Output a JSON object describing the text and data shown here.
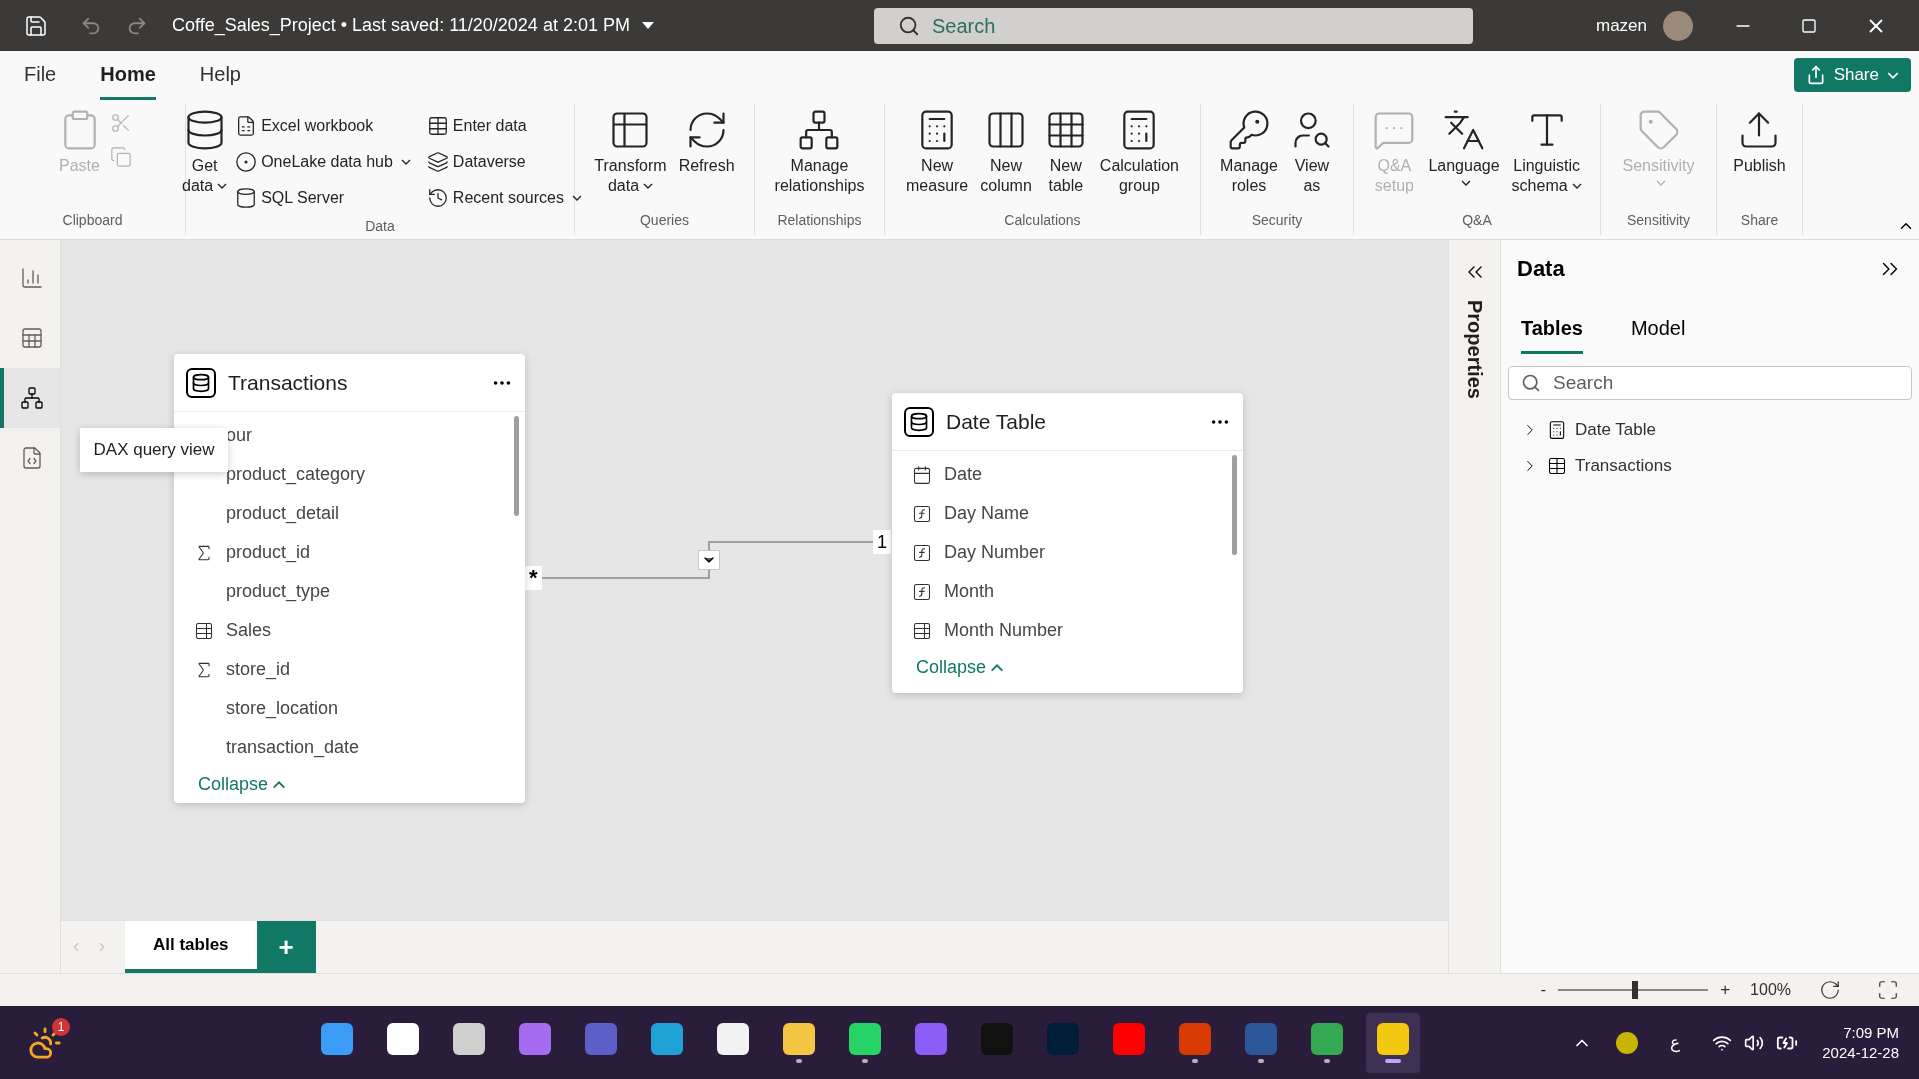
{
  "title_bar": {
    "file_title": "Coffe_Sales_Project • Last saved: 11/20/2024 at 2:01 PM",
    "search_placeholder": "Search",
    "user": "mazen"
  },
  "menu_tabs": [
    {
      "label": "File",
      "selected": false
    },
    {
      "label": "Home",
      "selected": true
    },
    {
      "label": "Help",
      "selected": false
    }
  ],
  "share_button": "Share",
  "ribbon_groups": [
    {
      "label": "Clipboard",
      "buttons": [
        {
          "lines": [
            "Paste"
          ],
          "kind": "large",
          "disabled": true,
          "dropdown": false
        },
        {
          "kind": "icon",
          "disabled": true,
          "dropdown": false
        },
        {
          "kind": "icon",
          "disabled": true,
          "dropdown": false
        }
      ]
    },
    {
      "label": "Data",
      "buttons": [
        {
          "lines": [
            "Get",
            "data"
          ],
          "kind": "large",
          "disabled": false,
          "dropdown": true
        },
        {
          "lines": [
            "Excel workbook"
          ],
          "kind": "small",
          "disabled": false,
          "dropdown": false
        },
        {
          "lines": [
            "OneLake data hub"
          ],
          "kind": "small",
          "disabled": false,
          "dropdown": true
        },
        {
          "lines": [
            "SQL Server"
          ],
          "kind": "small",
          "disabled": false,
          "dropdown": false
        },
        {
          "lines": [
            "Enter data"
          ],
          "kind": "small",
          "disabled": false,
          "dropdown": false
        },
        {
          "lines": [
            "Dataverse"
          ],
          "kind": "small",
          "disabled": false,
          "dropdown": false
        },
        {
          "lines": [
            "Recent sources"
          ],
          "kind": "small",
          "disabled": false,
          "dropdown": true
        }
      ]
    },
    {
      "label": "Queries",
      "buttons": [
        {
          "lines": [
            "Transform",
            "data"
          ],
          "kind": "large",
          "disabled": false,
          "dropdown": true
        },
        {
          "lines": [
            "Refresh"
          ],
          "kind": "large",
          "disabled": false,
          "dropdown": false
        }
      ]
    },
    {
      "label": "Relationships",
      "buttons": [
        {
          "lines": [
            "Manage",
            "relationships"
          ],
          "kind": "large",
          "disabled": false,
          "dropdown": false
        }
      ]
    },
    {
      "label": "Calculations",
      "buttons": [
        {
          "lines": [
            "New",
            "measure"
          ],
          "kind": "large",
          "disabled": false,
          "dropdown": false
        },
        {
          "lines": [
            "New",
            "column"
          ],
          "kind": "large",
          "disabled": false,
          "dropdown": false
        },
        {
          "lines": [
            "New",
            "table"
          ],
          "kind": "large",
          "disabled": false,
          "dropdown": false
        },
        {
          "lines": [
            "Calculation",
            "group"
          ],
          "kind": "large",
          "disabled": false,
          "dropdown": false
        }
      ]
    },
    {
      "label": "Security",
      "buttons": [
        {
          "lines": [
            "Manage",
            "roles"
          ],
          "kind": "large",
          "disabled": false,
          "dropdown": false
        },
        {
          "lines": [
            "View",
            "as"
          ],
          "kind": "large",
          "disabled": false,
          "dropdown": false
        }
      ]
    },
    {
      "label": "Q&A",
      "buttons": [
        {
          "lines": [
            "Q&A",
            "setup"
          ],
          "kind": "large",
          "disabled": true,
          "dropdown": false
        },
        {
          "lines": [
            "Language"
          ],
          "kind": "large",
          "disabled": false,
          "dropdown": true
        },
        {
          "lines": [
            "Linguistic",
            "schema"
          ],
          "kind": "large",
          "disabled": false,
          "dropdown": true
        }
      ]
    },
    {
      "label": "Sensitivity",
      "buttons": [
        {
          "lines": [
            "Sensitivity"
          ],
          "kind": "large",
          "disabled": true,
          "dropdown": true
        }
      ]
    },
    {
      "label": "Share",
      "buttons": [
        {
          "lines": [
            "Publish"
          ],
          "kind": "large",
          "disabled": false,
          "dropdown": false
        }
      ]
    }
  ],
  "view_nav": [
    {
      "selected": false
    },
    {
      "selected": false
    },
    {
      "selected": true
    },
    {
      "selected": false
    }
  ],
  "tooltip": "DAX query view",
  "tables": [
    {
      "name": "Transactions",
      "collapse": "Collapse",
      "fields": [
        {
          "name": "our",
          "kind": "plain"
        },
        {
          "name": "product_category",
          "kind": "plain"
        },
        {
          "name": "product_detail",
          "kind": "plain"
        },
        {
          "name": "product_id",
          "kind": "sum"
        },
        {
          "name": "product_type",
          "kind": "plain"
        },
        {
          "name": "Sales",
          "kind": "calc_sum"
        },
        {
          "name": "store_id",
          "kind": "sum"
        },
        {
          "name": "store_location",
          "kind": "plain"
        },
        {
          "name": "transaction_date",
          "kind": "plain"
        }
      ]
    },
    {
      "name": "Date Table",
      "collapse": "Collapse",
      "fields": [
        {
          "name": "Date",
          "kind": "date"
        },
        {
          "name": "Day Name",
          "kind": "fx"
        },
        {
          "name": "Day Number",
          "kind": "fx"
        },
        {
          "name": "Month",
          "kind": "fx"
        },
        {
          "name": "Month Number",
          "kind": "calc_sum"
        }
      ]
    }
  ],
  "relationship": {
    "many_label": "*",
    "one_label": "1"
  },
  "properties_label": "Properties",
  "data_pane": {
    "title": "Data",
    "tabs": [
      {
        "label": "Tables",
        "selected": true
      },
      {
        "label": "Model",
        "selected": false
      }
    ],
    "search_placeholder": "Search",
    "tree": [
      {
        "label": "Date Table",
        "kind": "calc_table",
        "expanded": false
      },
      {
        "label": "Transactions",
        "kind": "table",
        "expanded": false
      }
    ]
  },
  "page_tabs": [
    {
      "label": "All tables",
      "selected": true
    }
  ],
  "add_tab": "+",
  "zoom": {
    "minus": "-",
    "plus": "+",
    "level": 0.51,
    "reading": "100%"
  },
  "taskbar": {
    "weather_badge": "1",
    "apps": [
      {
        "kind": "start",
        "running": false,
        "selected": false
      },
      {
        "kind": "search",
        "running": false,
        "selected": false
      },
      {
        "kind": "taskview",
        "running": false,
        "selected": false
      },
      {
        "kind": "copilot",
        "running": false,
        "selected": false
      },
      {
        "kind": "teams",
        "running": false,
        "selected": false
      },
      {
        "kind": "edge",
        "running": false,
        "selected": false
      },
      {
        "kind": "store",
        "running": false,
        "selected": false
      },
      {
        "kind": "folder",
        "running": true,
        "selected": false
      },
      {
        "kind": "chat",
        "running": true,
        "selected": false
      },
      {
        "kind": "messenger",
        "running": false,
        "selected": false
      },
      {
        "kind": "note",
        "running": false,
        "selected": false
      },
      {
        "kind": "ps",
        "running": false,
        "selected": false
      },
      {
        "kind": "video",
        "running": false,
        "selected": false
      },
      {
        "kind": "office",
        "running": true,
        "selected": false
      },
      {
        "kind": "word",
        "running": true,
        "selected": false
      },
      {
        "kind": "browser",
        "running": true,
        "selected": false
      },
      {
        "kind": "bi",
        "running": true,
        "selected": true
      }
    ],
    "language": "ع",
    "time": "7:09 PM",
    "date": "2024-12-28"
  }
}
